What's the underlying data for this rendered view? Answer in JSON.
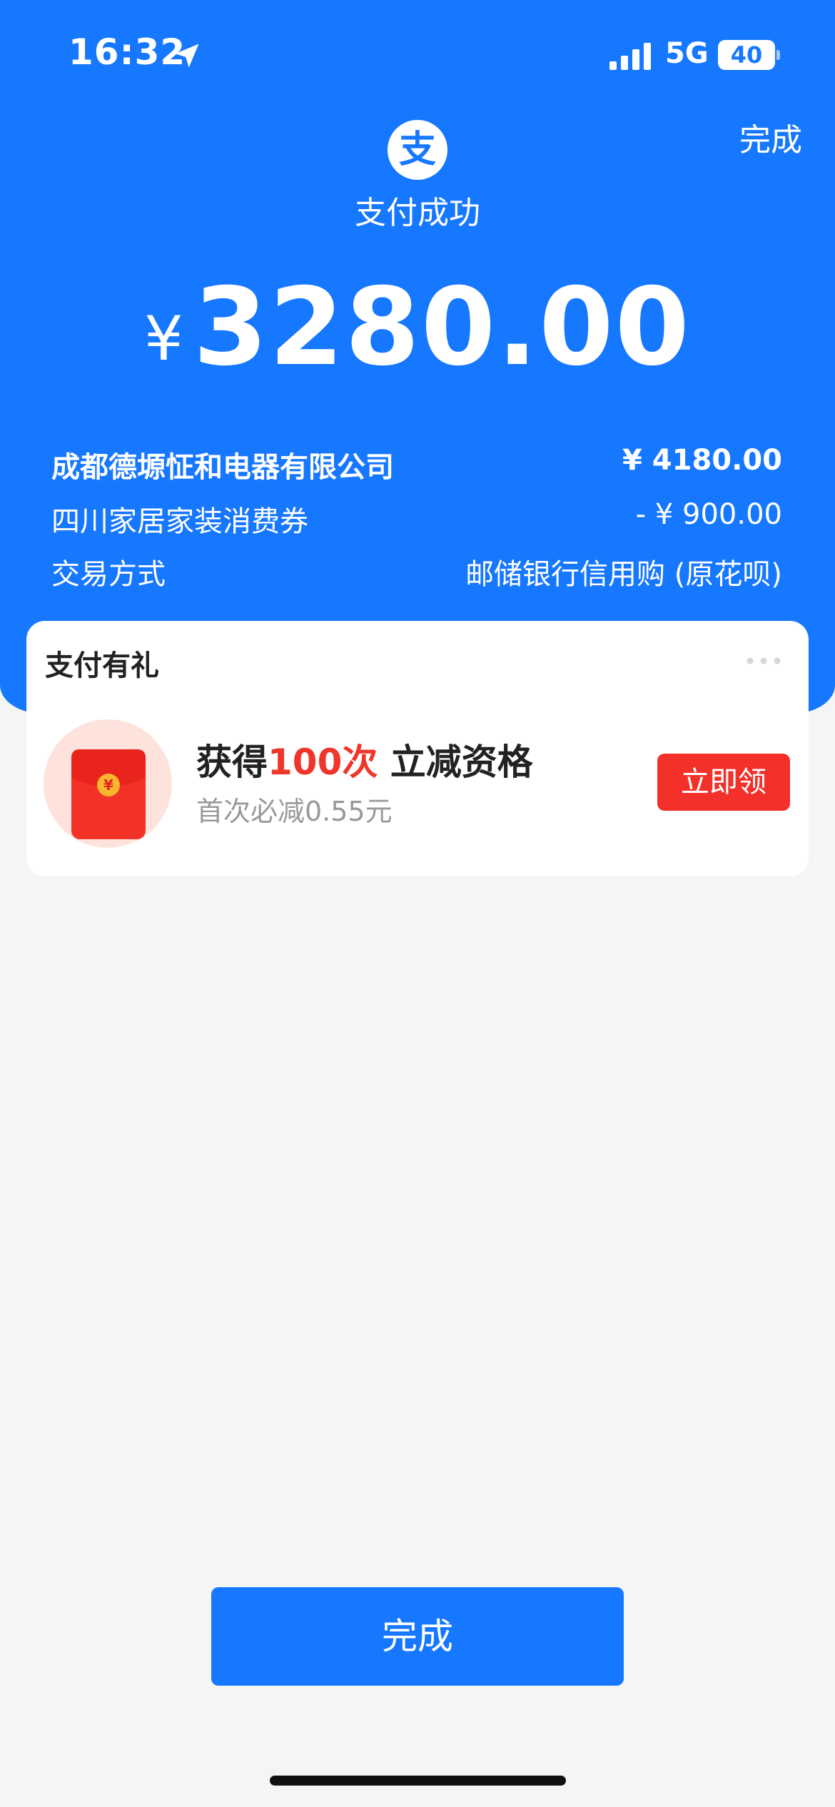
{
  "status_bar": {
    "time": "16:32",
    "network": "5G",
    "battery": "40"
  },
  "header": {
    "done_label": "完成",
    "logo_glyph": "支",
    "title": "支付成功"
  },
  "payment": {
    "currency_symbol": "¥",
    "amount": "3280.00"
  },
  "details": [
    {
      "label": "成都德塬怔和电器有限公司",
      "value": "¥ 4180.00"
    },
    {
      "label": "四川家居家装消费券",
      "value": "- ¥ 900.00"
    },
    {
      "label": "交易方式",
      "value": "邮储银行信用购 (原花呗)"
    }
  ],
  "gift": {
    "title": "支付有礼",
    "main_prefix": "获得",
    "main_highlight": "100次",
    "main_suffix": "立减资格",
    "subtitle": "首次必减0.55元",
    "claim_label": "立即领",
    "envelope_glyph": "¥"
  },
  "footer": {
    "done_label": "完成"
  },
  "colors": {
    "brand_blue": "#1677ff",
    "accent_red": "#f4302a",
    "background": "#f5f5f5"
  },
  "icons": [
    "location-arrow-icon",
    "signal-icon",
    "battery-icon",
    "alipay-logo-icon",
    "more-dots-icon",
    "red-envelope-icon"
  ]
}
